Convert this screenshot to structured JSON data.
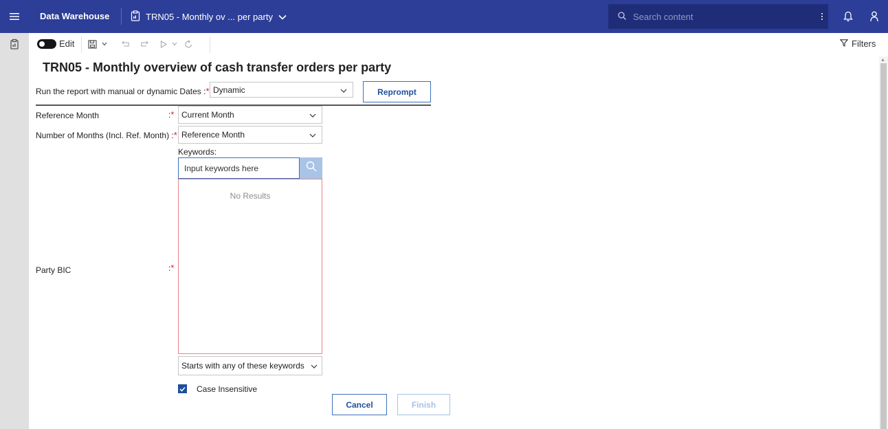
{
  "topbar": {
    "app_name": "Data Warehouse",
    "report_tab": "TRN05 - Monthly ov ... per party",
    "search_placeholder": "Search content"
  },
  "toolbar": {
    "edit_label": "Edit",
    "filters_label": "Filters"
  },
  "report": {
    "title": "TRN05 - Monthly overview of cash transfer orders per party",
    "dates_label": "Run the report with manual or dynamic Dates :",
    "dates_value": "Dynamic",
    "reprompt_label": "Reprompt",
    "ref_month_label": "Reference Month",
    "ref_month_value": "Current Month",
    "num_months_label": "Number of Months (Incl. Ref. Month) :",
    "num_months_value": "Reference Month",
    "keywords_label": "Keywords:",
    "keywords_placeholder": "Input keywords here",
    "no_results": "No Results",
    "party_bic_label": "Party BIC",
    "match_mode": "Starts with any of these keywords",
    "case_insensitive_label": "Case Insensitive",
    "case_insensitive_checked": true,
    "cancel_label": "Cancel",
    "finish_label": "Finish",
    "colon": ":",
    "required_marker": "*"
  },
  "colors": {
    "topbar": "#2c3e98",
    "accent": "#1f4f9b",
    "required": "#da1e28"
  }
}
